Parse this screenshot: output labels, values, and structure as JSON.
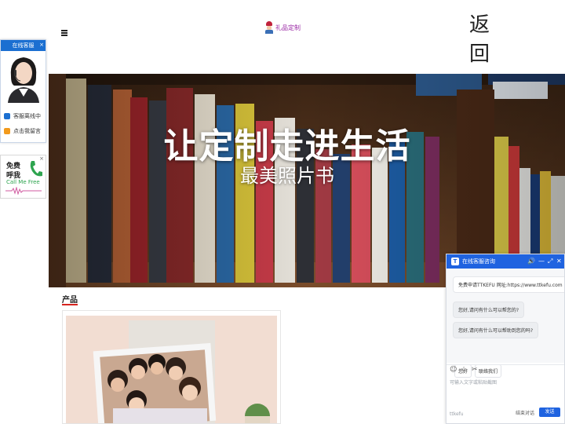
{
  "header": {
    "logo_text": "礼品定制",
    "back_label": "返回"
  },
  "hero": {
    "title": "让定制走进生活",
    "subtitle": "最美照片书"
  },
  "products": {
    "section_title": "产品"
  },
  "kefu_widget": {
    "title": "在线客服",
    "close": "×",
    "status": "客服离线中",
    "leave_message": "点击我留言"
  },
  "call_widget": {
    "close": "×",
    "line1": "免费",
    "line2": "呼我",
    "english": "Call Me Free"
  },
  "chat": {
    "title": "在线客服咨询",
    "controls": {
      "minimize": "—",
      "expand": "⤢",
      "close": "✕"
    },
    "messages": [
      "免费申请TTKEFU 网址:https://www.ttkefu.com",
      "您好,请问有什么可以帮您的?",
      "您好,请问有什么可以帮助到您的吗?"
    ],
    "quick_replies": [
      "您好",
      "联络我们"
    ],
    "input_placeholder": "可输入文字或粘贴截图",
    "brand": "ttkefu",
    "end_label": "结束对话",
    "send_label": "发送"
  },
  "colors": {
    "accent_red": "#d6231e",
    "chat_blue": "#1f63e0",
    "kefu_blue": "#1b6fd1",
    "logo_purple": "#9b2aa6"
  },
  "icons": {
    "menu": "hamburger-icon",
    "chat_sound": "speaker-icon",
    "emoji": "emoji-icon",
    "star": "star-icon",
    "scissors": "scissors-icon"
  }
}
